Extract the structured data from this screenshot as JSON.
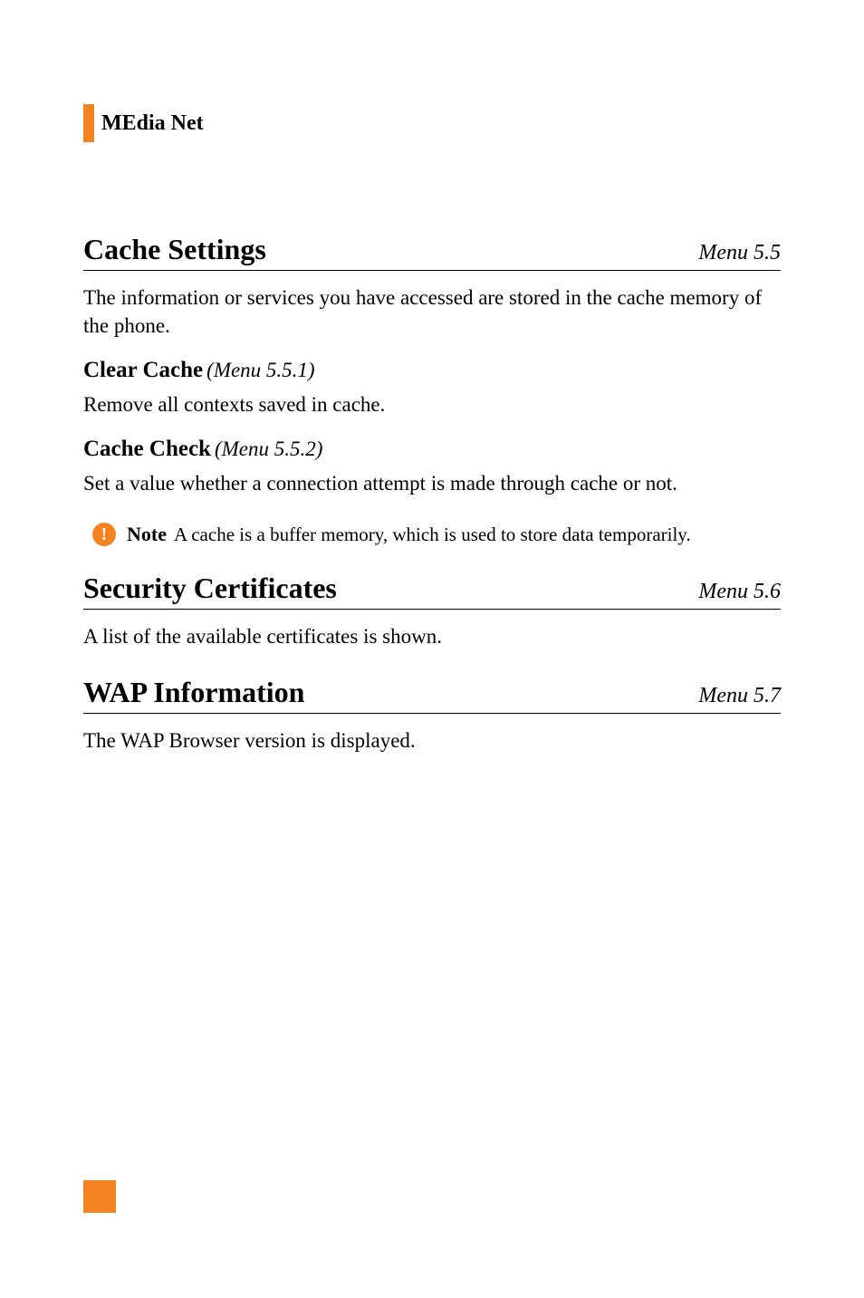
{
  "header": {
    "title": "MEdia Net"
  },
  "sections": [
    {
      "title": "Cache Settings",
      "menu": "Menu 5.5",
      "intro": "The information or services you have accessed are stored in the cache memory of the phone.",
      "subsections": [
        {
          "title": "Clear Cache",
          "menu": "(Menu 5.5.1)",
          "text": "Remove all contexts saved in cache."
        },
        {
          "title": "Cache Check",
          "menu": "(Menu 5.5.2)",
          "text": "Set a value whether a connection attempt is made through cache or not."
        }
      ],
      "note": {
        "label": "Note",
        "text": "A cache is a buffer memory, which is used to store data temporarily."
      }
    },
    {
      "title": "Security Certificates",
      "menu": "Menu 5.6",
      "intro": "A list of the available certificates is shown."
    },
    {
      "title": "WAP Information",
      "menu": "Menu 5.7",
      "intro": "The WAP Browser version is displayed."
    }
  ],
  "icons": {
    "exclaim": "!"
  }
}
